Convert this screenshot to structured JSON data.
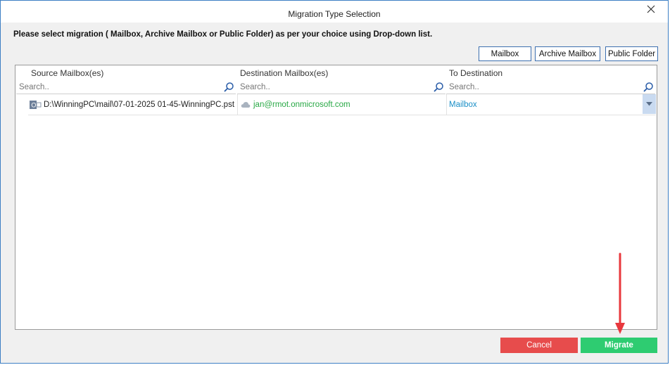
{
  "window": {
    "title": "Migration Type Selection"
  },
  "instruction": "Please select migration ( Mailbox, Archive Mailbox or Public Folder) as per your choice using Drop-down list.",
  "type_buttons": {
    "mailbox": "Mailbox",
    "archive": "Archive Mailbox",
    "public": "Public Folder"
  },
  "columns": {
    "source": "Source Mailbox(es)",
    "destination": "Destination Mailbox(es)",
    "to_destination": "To Destination"
  },
  "search": {
    "placeholder": "Search.."
  },
  "rows": [
    {
      "source": "D:\\WinningPC\\mail\\07-01-2025 01-45-WinningPC.pst",
      "destination": "jan@rmot.onmicrosoft.com",
      "to_destination": "Mailbox"
    }
  ],
  "footer": {
    "cancel": "Cancel",
    "migrate": "Migrate"
  },
  "colors": {
    "accent": "#3d7fc4",
    "destination_text": "#27a844",
    "link_text": "#1a8fc7",
    "cancel": "#e74c4c",
    "migrate": "#2ecc71",
    "arrow": "#e8383d"
  },
  "icons": [
    "close-icon",
    "search-icon",
    "outlook-pst-icon",
    "cloud-icon",
    "chevron-down-icon",
    "red-arrow-annotation"
  ]
}
